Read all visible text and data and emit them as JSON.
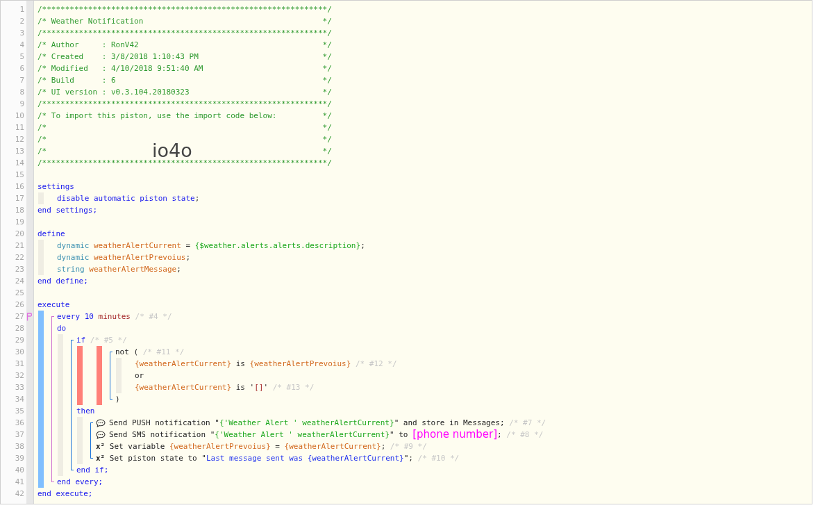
{
  "editor": {
    "items": [
      {
        "kind": "line",
        "number": "1",
        "tokens": [
          {
            "text": "/**************************************************************/",
            "kind": "comment"
          }
        ]
      },
      {
        "kind": "line",
        "number": "2",
        "tokens": [
          {
            "text": "/* Weather Notification",
            "kind": "comment"
          },
          {
            "text": "*/",
            "kind": "comment_end"
          }
        ]
      },
      {
        "kind": "line",
        "number": "3",
        "tokens": [
          {
            "text": "/**************************************************************/",
            "kind": "comment"
          }
        ]
      },
      {
        "kind": "line",
        "number": "4",
        "tokens": [
          {
            "text": "/* Author     : RonV42",
            "kind": "comment"
          },
          {
            "text": "*/",
            "kind": "comment_end"
          }
        ]
      },
      {
        "kind": "line",
        "number": "5",
        "tokens": [
          {
            "text": "/* Created    : 3/8/2018 1:10:43 PM",
            "kind": "comment"
          },
          {
            "text": "*/",
            "kind": "comment_end"
          }
        ]
      },
      {
        "kind": "line",
        "number": "6",
        "tokens": [
          {
            "text": "/* Modified   : 4/10/2018 9:51:40 AM",
            "kind": "comment"
          },
          {
            "text": "*/",
            "kind": "comment_end"
          }
        ]
      },
      {
        "kind": "line",
        "number": "7",
        "tokens": [
          {
            "text": "/* Build      : 6",
            "kind": "comment"
          },
          {
            "text": "*/",
            "kind": "comment_end"
          }
        ]
      },
      {
        "kind": "line",
        "number": "8",
        "tokens": [
          {
            "text": "/* UI version : v0.3.104.20180323",
            "kind": "comment"
          },
          {
            "text": "*/",
            "kind": "comment_end"
          }
        ]
      },
      {
        "kind": "line",
        "number": "9",
        "tokens": [
          {
            "text": "/**************************************************************/",
            "kind": "comment"
          }
        ]
      },
      {
        "kind": "line",
        "number": "10",
        "tokens": [
          {
            "text": "/* To import this piston, use the import code below:",
            "kind": "comment"
          },
          {
            "text": "*/",
            "kind": "comment_end"
          }
        ]
      },
      {
        "kind": "line",
        "number": "11",
        "tokens": [
          {
            "text": "/*",
            "kind": "comment"
          },
          {
            "text": "*/",
            "kind": "comment_end"
          }
        ]
      },
      {
        "kind": "line",
        "number": "12",
        "tokens": [
          {
            "text": "/*",
            "kind": "comment"
          },
          {
            "text": "*/",
            "kind": "comment_end"
          }
        ]
      },
      {
        "kind": "line",
        "number": "13",
        "tokens": [
          {
            "text": "/*",
            "kind": "comment"
          },
          {
            "text": "*/",
            "kind": "comment_end"
          }
        ],
        "import_code": "io4o"
      },
      {
        "kind": "line",
        "number": "14",
        "tokens": [
          {
            "text": "/**************************************************************/",
            "kind": "comment"
          }
        ]
      },
      {
        "kind": "line",
        "number": "15"
      },
      {
        "kind": "line",
        "number": "16",
        "tokens": [
          {
            "text": "settings",
            "kind": "keyword"
          }
        ]
      },
      {
        "kind": "block",
        "items": [
          {
            "kind": "line",
            "number": "17",
            "tokens": [
              {
                "text": "disable automatic piston state",
                "kind": "keyword"
              },
              {
                "text": ";",
                "kind": "plain"
              }
            ]
          }
        ]
      },
      {
        "kind": "line",
        "number": "18",
        "tokens": [
          {
            "text": "end settings;",
            "kind": "keyword"
          }
        ]
      },
      {
        "kind": "line",
        "number": "19"
      },
      {
        "kind": "line",
        "number": "20",
        "tokens": [
          {
            "text": "define",
            "kind": "keyword"
          }
        ]
      },
      {
        "kind": "block",
        "items": [
          {
            "kind": "line",
            "number": "21",
            "tokens": [
              {
                "text": "dynamic ",
                "kind": "type"
              },
              {
                "text": "weatherAlertCurrent",
                "kind": "variable"
              },
              {
                "text": " = ",
                "kind": "plain"
              },
              {
                "text": "{$weather.alerts.alerts.description}",
                "kind": "expression"
              },
              {
                "text": ";",
                "kind": "plain"
              }
            ]
          },
          {
            "kind": "line",
            "number": "22",
            "tokens": [
              {
                "text": "dynamic ",
                "kind": "type"
              },
              {
                "text": "weatherAlertPrevoius",
                "kind": "variable"
              },
              {
                "text": ";",
                "kind": "plain"
              }
            ]
          },
          {
            "kind": "line",
            "number": "23",
            "tokens": [
              {
                "text": "string ",
                "kind": "type"
              },
              {
                "text": "weatherAlertMessage",
                "kind": "variable"
              },
              {
                "text": ";",
                "kind": "plain"
              }
            ]
          }
        ]
      },
      {
        "kind": "line",
        "number": "24",
        "tokens": [
          {
            "text": "end define;",
            "kind": "keyword"
          }
        ]
      },
      {
        "kind": "line",
        "number": "25"
      },
      {
        "kind": "line",
        "number": "26",
        "tokens": [
          {
            "text": "execute",
            "kind": "keyword"
          }
        ]
      },
      {
        "kind": "block",
        "running": true,
        "items": [
          {
            "kind": "bracket",
            "color": "#d070d0",
            "items": [
              {
                "kind": "line",
                "number": "27",
                "marked": true,
                "tokens": [
                  {
                    "text": "every 10",
                    "kind": "keyword"
                  },
                  {
                    "text": " minutes",
                    "kind": "unit"
                  },
                  {
                    "text": " /* #4 */",
                    "kind": "note"
                  }
                ]
              },
              {
                "kind": "line",
                "number": "28",
                "tokens": [
                  {
                    "text": "do",
                    "kind": "keyword"
                  }
                ]
              },
              {
                "kind": "block",
                "items": [
                  {
                    "kind": "bracket",
                    "color": "#1a73d9",
                    "items": [
                      {
                        "kind": "line",
                        "number": "29",
                        "tokens": [
                          {
                            "text": "if",
                            "kind": "keyword"
                          },
                          {
                            "text": " /* #5 */",
                            "kind": "note"
                          }
                        ]
                      },
                      {
                        "kind": "block",
                        "failed": true,
                        "items": [
                          {
                            "kind": "block",
                            "failed": true,
                            "items": [
                              {
                                "kind": "bracket",
                                "color": "#1a73d9",
                                "items": [
                                  {
                                    "kind": "line",
                                    "number": "30",
                                    "tokens": [
                                      {
                                        "text": "not (",
                                        "kind": "plain"
                                      },
                                      {
                                        "text": " /* #11 */",
                                        "kind": "note"
                                      }
                                    ]
                                  },
                                  {
                                    "kind": "block",
                                    "items": [
                                      {
                                        "kind": "line",
                                        "number": "31",
                                        "tokens": [
                                          {
                                            "text": "{weatherAlertCurrent}",
                                            "kind": "variable"
                                          },
                                          {
                                            "text": " is ",
                                            "kind": "plain"
                                          },
                                          {
                                            "text": "{weatherAlertPrevoius}",
                                            "kind": "variable"
                                          },
                                          {
                                            "text": " /* #12 */",
                                            "kind": "note"
                                          }
                                        ]
                                      },
                                      {
                                        "kind": "line",
                                        "number": "32",
                                        "tokens": [
                                          {
                                            "text": "or",
                                            "kind": "plain"
                                          }
                                        ]
                                      },
                                      {
                                        "kind": "line",
                                        "number": "33",
                                        "tokens": [
                                          {
                                            "text": "{weatherAlertCurrent}",
                                            "kind": "variable"
                                          },
                                          {
                                            "text": " is '",
                                            "kind": "plain"
                                          },
                                          {
                                            "text": "[]",
                                            "kind": "unit"
                                          },
                                          {
                                            "text": "'",
                                            "kind": "plain"
                                          },
                                          {
                                            "text": " /* #13 */",
                                            "kind": "note"
                                          }
                                        ]
                                      }
                                    ]
                                  },
                                  {
                                    "kind": "line",
                                    "number": "34",
                                    "tokens": [
                                      {
                                        "text": ")",
                                        "kind": "plain"
                                      }
                                    ]
                                  }
                                ]
                              }
                            ]
                          }
                        ]
                      },
                      {
                        "kind": "line",
                        "number": "35",
                        "tokens": [
                          {
                            "text": "then",
                            "kind": "keyword"
                          }
                        ]
                      },
                      {
                        "kind": "block",
                        "items": [
                          {
                            "kind": "bracket",
                            "color": "#1a73d9",
                            "items": [
                              {
                                "kind": "message",
                                "number": "36",
                                "tokens": [
                                  {
                                    "text": "Send PUSH notification \"",
                                    "kind": "plain"
                                  },
                                  {
                                    "text": "{'Weather Alert ' weatherAlertCurrent}",
                                    "kind": "expression"
                                  },
                                  {
                                    "text": "\" and store in Messages;",
                                    "kind": "plain"
                                  },
                                  {
                                    "text": " /* #7 */",
                                    "kind": "note"
                                  }
                                ]
                              },
                              {
                                "kind": "message",
                                "number": "37",
                                "tokens": [
                                  {
                                    "text": "Send SMS notification \"",
                                    "kind": "plain"
                                  },
                                  {
                                    "text": "{'Weather Alert ' weatherAlertCurrent}",
                                    "kind": "expression"
                                  },
                                  {
                                    "text": "\" to ",
                                    "kind": "plain"
                                  },
                                  {
                                    "text": "[phone number]",
                                    "kind": "highlight"
                                  },
                                  {
                                    "text": ";",
                                    "kind": "plain"
                                  },
                                  {
                                    "text": " /* #8 */",
                                    "kind": "note"
                                  }
                                ]
                              },
                              {
                                "kind": "line",
                                "number": "38",
                                "tokens": [
                                  {
                                    "text": "x²",
                                    "kind": "symbol"
                                  },
                                  {
                                    "text": " Set variable ",
                                    "kind": "plain"
                                  },
                                  {
                                    "text": "{weatherAlertPrevoius}",
                                    "kind": "variable"
                                  },
                                  {
                                    "text": " = ",
                                    "kind": "plain"
                                  },
                                  {
                                    "text": "{weatherAlertCurrent}",
                                    "kind": "variable"
                                  },
                                  {
                                    "text": ";",
                                    "kind": "plain"
                                  },
                                  {
                                    "text": " /* #9 */",
                                    "kind": "note"
                                  }
                                ]
                              },
                              {
                                "kind": "line",
                                "number": "39",
                                "tokens": [
                                  {
                                    "text": "x²",
                                    "kind": "symbol"
                                  },
                                  {
                                    "text": " Set piston state to \"",
                                    "kind": "plain"
                                  },
                                  {
                                    "text": "Last message sent was {weatherAlertCurrent}",
                                    "kind": "literal"
                                  },
                                  {
                                    "text": "\";",
                                    "kind": "plain"
                                  },
                                  {
                                    "text": " /* #10 */",
                                    "kind": "note"
                                  }
                                ]
                              }
                            ]
                          }
                        ]
                      },
                      {
                        "kind": "line",
                        "number": "40",
                        "tokens": [
                          {
                            "text": "end if;",
                            "kind": "keyword"
                          }
                        ]
                      }
                    ]
                  }
                ]
              },
              {
                "kind": "line",
                "number": "41",
                "tokens": [
                  {
                    "text": "end every;",
                    "kind": "keyword"
                  }
                ]
              }
            ]
          }
        ]
      },
      {
        "kind": "line",
        "number": "42",
        "tokens": [
          {
            "text": "end execute;",
            "kind": "keyword"
          }
        ]
      }
    ]
  }
}
